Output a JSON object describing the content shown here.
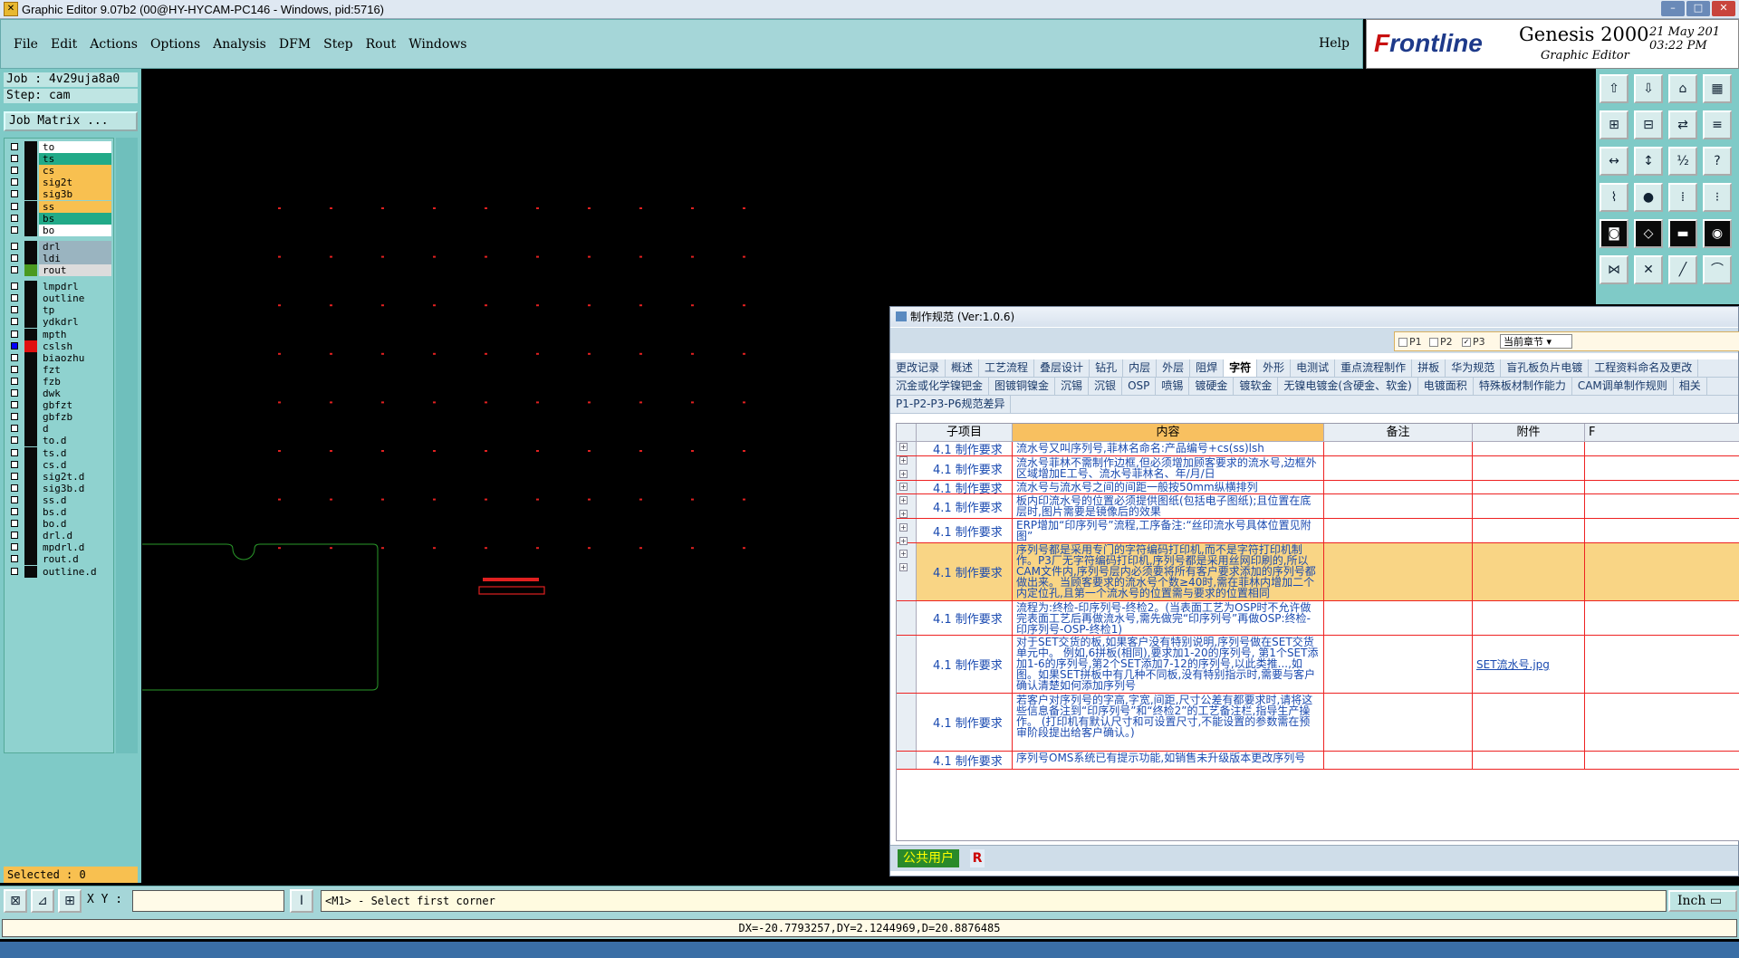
{
  "window": {
    "title": "Graphic Editor 9.07b2 (00@HY-HYCAM-PC146 - Windows, pid:5716)"
  },
  "menu": {
    "items": [
      "File",
      "Edit",
      "Actions",
      "Options",
      "Analysis",
      "DFM",
      "Step",
      "Rout",
      "Windows"
    ],
    "help": "Help"
  },
  "brand": {
    "logo_prefix": "F",
    "logo_rest": "rontline",
    "product": "Genesis 2000",
    "subtitle": "Graphic Editor",
    "date": "21 May 201",
    "time": "03:22 PM"
  },
  "job": {
    "job_line": "Job : 4v29uja8a0",
    "step_line": "Step: cam",
    "matrix_button": "Job Matrix ..."
  },
  "layers": [
    {
      "name": "to",
      "color": "#ffffff",
      "group": 0
    },
    {
      "name": "ts",
      "color": "#22aa88",
      "group": 0
    },
    {
      "name": "cs",
      "color": "#f8c050",
      "group": 0
    },
    {
      "name": "sig2t",
      "color": "#f8c050",
      "group": 0
    },
    {
      "name": "sig3b",
      "color": "#f8c050",
      "group": 0
    },
    {
      "name": "ss",
      "color": "#f8c050",
      "group": 0
    },
    {
      "name": "bs",
      "color": "#22aa88",
      "group": 0
    },
    {
      "name": "bo",
      "color": "#ffffff",
      "group": 0
    },
    {
      "name": "drl",
      "color": "#9ab4c0",
      "group": 1
    },
    {
      "name": "ldi",
      "color": "#9ab4c0",
      "group": 1
    },
    {
      "name": "rout",
      "color": "#dcdcdc",
      "group": 1
    },
    {
      "name": "lmpdrl",
      "color": "#8fd2cf",
      "group": 2
    },
    {
      "name": "outline",
      "color": "#8fd2cf",
      "group": 2
    },
    {
      "name": "tp",
      "color": "#8fd2cf",
      "group": 2
    },
    {
      "name": "ydkdrl",
      "color": "#8fd2cf",
      "group": 2
    },
    {
      "name": "mpth",
      "color": "#8fd2cf",
      "group": 2
    },
    {
      "name": "cslsh",
      "color": "#8fd2cf",
      "group": 2
    },
    {
      "name": "biaozhu",
      "color": "#8fd2cf",
      "group": 2
    },
    {
      "name": "fzt",
      "color": "#8fd2cf",
      "group": 2
    },
    {
      "name": "fzb",
      "color": "#8fd2cf",
      "group": 2
    },
    {
      "name": "dwk",
      "color": "#8fd2cf",
      "group": 2
    },
    {
      "name": "gbfzt",
      "color": "#8fd2cf",
      "group": 2
    },
    {
      "name": "gbfzb",
      "color": "#8fd2cf",
      "group": 2
    },
    {
      "name": "d",
      "color": "#8fd2cf",
      "group": 2
    },
    {
      "name": "to.d",
      "color": "#8fd2cf",
      "group": 2
    },
    {
      "name": "ts.d",
      "color": "#8fd2cf",
      "group": 2
    },
    {
      "name": "cs.d",
      "color": "#8fd2cf",
      "group": 2
    },
    {
      "name": "sig2t.d",
      "color": "#8fd2cf",
      "group": 2
    },
    {
      "name": "sig3b.d",
      "color": "#8fd2cf",
      "group": 2
    },
    {
      "name": "ss.d",
      "color": "#8fd2cf",
      "group": 2
    },
    {
      "name": "bs.d",
      "color": "#8fd2cf",
      "group": 2
    },
    {
      "name": "bo.d",
      "color": "#8fd2cf",
      "group": 2
    },
    {
      "name": "drl.d",
      "color": "#8fd2cf",
      "group": 2
    },
    {
      "name": "mpdrl.d",
      "color": "#8fd2cf",
      "group": 2
    },
    {
      "name": "rout.d",
      "color": "#8fd2cf",
      "group": 2
    },
    {
      "name": "outline.d",
      "color": "#8fd2cf",
      "group": 2
    }
  ],
  "status": {
    "selected": "Selected : 0",
    "xy_label": "X Y :",
    "prompt": "<M1> - Select first corner",
    "units": "Inch",
    "delta": "DX=-20.7793257,DY=2.1244969,D=20.8876485"
  },
  "dialog": {
    "title": "制作规范 (Ver:1.0.6)",
    "filters": [
      "P1",
      "P2",
      "P3"
    ],
    "chapter": "当前章节",
    "tabs1": [
      "更改记录",
      "概述",
      "工艺流程",
      "叠层设计",
      "钻孔",
      "内层",
      "外层",
      "阻焊",
      "字符",
      "外形",
      "电测试",
      "重点流程制作",
      "拼板",
      "华为规范",
      "盲孔板负片电镀",
      "工程资料命名及更改"
    ],
    "tabs2": [
      "沉金或化学镍钯金",
      "图镀铜镍金",
      "沉锡",
      "沉银",
      "OSP",
      "喷锡",
      "镀硬金",
      "镀软金",
      "无镍电镀金(含硬金、软金)",
      "电镀面积",
      "特殊板材制作能力",
      "CAM调单制作规则",
      "相关"
    ],
    "tabs3": [
      "P1-P2-P3-P6规范差异"
    ],
    "active_tab": "字符",
    "columns": [
      "子项目",
      "内容",
      "备注",
      "附件",
      "F"
    ],
    "rows": [
      {
        "sub": "4.1 制作要求",
        "content": "流水号又叫序列号,菲林名命名:产品编号+cs(ss)lsh",
        "attach": ""
      },
      {
        "sub": "4.1 制作要求",
        "content": "流水号菲林不需制作边框,但必须增加顾客要求的流水号,边框外区域增加E工号、流水号菲林名、年/月/日",
        "attach": ""
      },
      {
        "sub": "4.1 制作要求",
        "content": "流水号与流水号之间的间距一般按50mm纵横排列",
        "attach": ""
      },
      {
        "sub": "4.1 制作要求",
        "content": "板内印流水号的位置必须提供图纸(包括电子图纸);且位置在底层时,图片需要是镜像后的效果",
        "attach": ""
      },
      {
        "sub": "4.1 制作要求",
        "content": "ERP增加“印序列号”流程,工序备注:“丝印流水号具体位置见附图”",
        "attach": ""
      },
      {
        "sub": "4.1 制作要求",
        "content": "序列号都是采用专门的字符编码打印机,而不是字符打印机制作。P3厂无字符编码打印机,序列号都是采用丝网印刷的,所以CAM文件内,序列号层内必须要将所有客户要求添加的序列号都做出来。当顾客要求的流水号个数≥40时,需在菲林内增加二个内定位孔,且第一个流水号的位置需与要求的位置相同",
        "attach": ""
      },
      {
        "sub": "4.1 制作要求",
        "content": "流程为:终检-印序列号-终检2。(当表面工艺为OSP时不允许做完表面工艺后再做流水号,需先做完“印序列号”再做OSP:终检-印序列号-OSP-终检1)",
        "attach": ""
      },
      {
        "sub": "4.1 制作要求",
        "content": "对于SET交货的板,如果客户没有特别说明,序列号做在SET交货单元中。 例如,6拼板(相同),要求加1-20的序列号, 第1个SET添加1-6的序列号,第2个SET添加7-12的序列号,以此类推...,如图。如果SET拼板中有几种不同板,没有特别指示时,需要与客户确认清楚如何添加序列号",
        "attach": "SET流水号.jpg"
      },
      {
        "sub": "4.1 制作要求",
        "content": "若客户对序列号的字高,字宽,间距,尺寸公差有都要求时,请将这些信息备注到“印序列号”和“终检2”的工艺备注栏,指导生产操作。 (打印机有默认尺寸和可设置尺寸,不能设置的参数需在预审阶段提出给客户确认。)",
        "attach": ""
      },
      {
        "sub": "4.1 制作要求",
        "content": "序列号OMS系统已有提示功能,如销售未升级版本更改序列号",
        "attach": ""
      }
    ],
    "footer_user": "公共用户",
    "footer_r": "R"
  }
}
